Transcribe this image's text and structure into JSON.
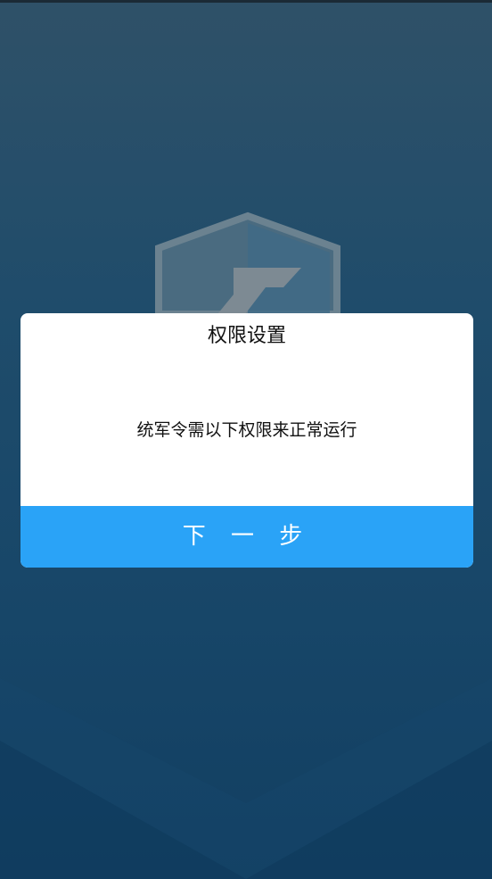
{
  "dialog": {
    "title": "权限设置",
    "message": "统军令需以下权限来正常运行",
    "next_button_label": "下 一 步"
  },
  "background": {
    "logo_icon": "shield-logo-icon"
  },
  "colors": {
    "button": "#2aa3f7",
    "background_top": "#2f5168",
    "background_bottom": "#123f62",
    "dialog": "#ffffff"
  }
}
